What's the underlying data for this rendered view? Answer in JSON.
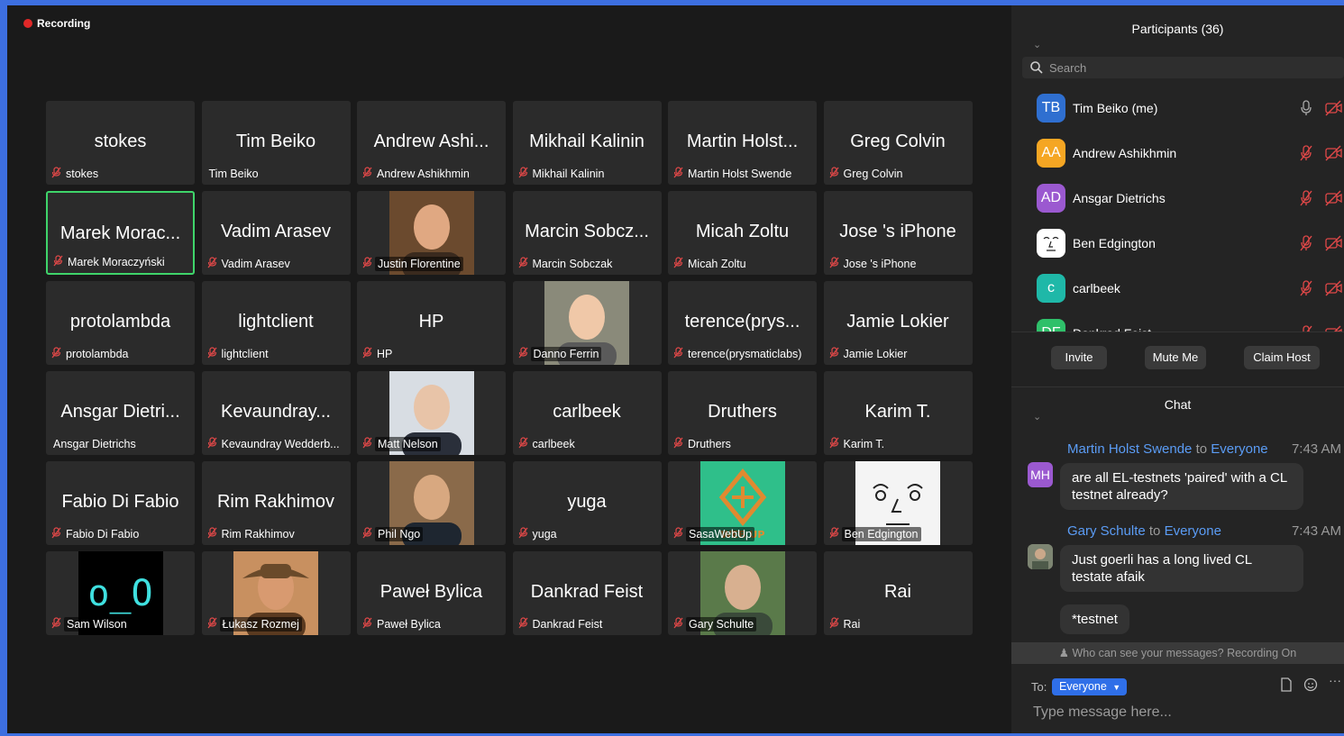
{
  "recording_label": "Recording",
  "tiles": [
    {
      "title": "stokes",
      "foot": "stokes",
      "muted": true,
      "photo": ""
    },
    {
      "title": "Tim Beiko",
      "foot": "Tim Beiko",
      "muted": false,
      "photo": ""
    },
    {
      "title": "Andrew Ashi...",
      "foot": "Andrew Ashikhmin",
      "muted": true,
      "photo": ""
    },
    {
      "title": "Mikhail Kalinin",
      "foot": "Mikhail Kalinin",
      "muted": true,
      "photo": ""
    },
    {
      "title": "Martin Holst...",
      "foot": "Martin Holst Swende",
      "muted": true,
      "photo": ""
    },
    {
      "title": "Greg Colvin",
      "foot": "Greg Colvin",
      "muted": true,
      "photo": ""
    },
    {
      "title": "Marek Morac...",
      "foot": "Marek Moraczyński",
      "muted": true,
      "photo": "",
      "active": true
    },
    {
      "title": "Vadim Arasev",
      "foot": "Vadim Arasev",
      "muted": true,
      "photo": ""
    },
    {
      "title": "",
      "foot": "Justin Florentine",
      "muted": true,
      "photo": "face-warm"
    },
    {
      "title": "Marcin Sobcz...",
      "foot": "Marcin Sobczak",
      "muted": true,
      "photo": ""
    },
    {
      "title": "Micah Zoltu",
      "foot": "Micah Zoltu",
      "muted": true,
      "photo": ""
    },
    {
      "title": "Jose 's iPhone",
      "foot": "Jose 's iPhone",
      "muted": true,
      "photo": ""
    },
    {
      "title": "protolambda",
      "foot": "protolambda",
      "muted": true,
      "photo": ""
    },
    {
      "title": "lightclient",
      "foot": "lightclient",
      "muted": true,
      "photo": ""
    },
    {
      "title": "HP",
      "foot": "HP",
      "muted": true,
      "photo": ""
    },
    {
      "title": "",
      "foot": "Danno Ferrin",
      "muted": true,
      "photo": "face-light"
    },
    {
      "title": "terence(prys...",
      "foot": "terence(prysmaticlabs)",
      "muted": true,
      "photo": ""
    },
    {
      "title": "Jamie Lokier",
      "foot": "Jamie Lokier",
      "muted": true,
      "photo": ""
    },
    {
      "title": "Ansgar Dietri...",
      "foot": "Ansgar Dietrichs",
      "muted": false,
      "photo": ""
    },
    {
      "title": "Kevaundray...",
      "foot": "Kevaundray Wedderb...",
      "muted": true,
      "photo": ""
    },
    {
      "title": "",
      "foot": "Matt Nelson",
      "muted": true,
      "photo": "face-office"
    },
    {
      "title": "carlbeek",
      "foot": "carlbeek",
      "muted": true,
      "photo": ""
    },
    {
      "title": "Druthers",
      "foot": "Druthers",
      "muted": true,
      "photo": ""
    },
    {
      "title": "Karim T.",
      "foot": "Karim T.",
      "muted": true,
      "photo": ""
    },
    {
      "title": "Fabio Di Fabio",
      "foot": "Fabio Di Fabio",
      "muted": true,
      "photo": ""
    },
    {
      "title": "Rim Rakhimov",
      "foot": "Rim Rakhimov",
      "muted": true,
      "photo": ""
    },
    {
      "title": "",
      "foot": "Phil Ngo",
      "muted": true,
      "photo": "face-suit"
    },
    {
      "title": "yuga",
      "foot": "yuga",
      "muted": true,
      "photo": ""
    },
    {
      "title": "",
      "foot": "SasaWebUp",
      "muted": true,
      "photo": "logo-green"
    },
    {
      "title": "",
      "foot": "Ben Edgington",
      "muted": true,
      "photo": "sketch"
    },
    {
      "title": "",
      "foot": "Sam Wilson",
      "muted": true,
      "photo": "terminal",
      "photo_text": "o_O"
    },
    {
      "title": "",
      "foot": "Łukasz Rozmej",
      "muted": true,
      "photo": "cowboy"
    },
    {
      "title": "Paweł Bylica",
      "foot": "Paweł Bylica",
      "muted": true,
      "photo": ""
    },
    {
      "title": "Dankrad Feist",
      "foot": "Dankrad Feist",
      "muted": true,
      "photo": ""
    },
    {
      "title": "",
      "foot": "Gary Schulte",
      "muted": true,
      "photo": "face-outdoor"
    },
    {
      "title": "Rai",
      "foot": "Rai",
      "muted": true,
      "photo": ""
    }
  ],
  "panel": {
    "participants_title": "Participants (36)",
    "search_placeholder": "Search",
    "participants": [
      {
        "initials": "TB",
        "name": "Tim Beiko (me)",
        "color": "#2f6fd0",
        "mic_muted": false
      },
      {
        "initials": "AA",
        "name": "Andrew Ashikhmin",
        "color": "#f5a623",
        "mic_muted": true
      },
      {
        "initials": "AD",
        "name": "Ansgar Dietrichs",
        "color": "#9b59d0",
        "mic_muted": true
      },
      {
        "initials": "",
        "name": "Ben Edgington",
        "color": "#ffffff",
        "mic_muted": true,
        "sketch": true
      },
      {
        "initials": "c",
        "name": "carlbeek",
        "color": "#1fb8a8",
        "mic_muted": true
      },
      {
        "initials": "DF",
        "name": "Dankrad Feist",
        "color": "#2fc06a",
        "mic_muted": true
      }
    ],
    "buttons": {
      "invite": "Invite",
      "mute": "Mute Me",
      "claim": "Claim Host"
    },
    "chat_title": "Chat",
    "messages": [
      {
        "sender": "Martin Holst Swende",
        "to_word": "to",
        "to": "Everyone",
        "time": "7:43 AM",
        "initials": "MH",
        "text": "are all EL-testnets 'paired' with a CL testnet already?"
      },
      {
        "sender": "Gary Schulte",
        "to_word": "to",
        "to": "Everyone",
        "time": "7:43 AM",
        "initials": "",
        "text": "Just goerli has a long lived CL testate afaik"
      },
      {
        "text": "*testnet"
      }
    ],
    "notice": "Who can see your messages? Recording On",
    "to_label": "To:",
    "to_value": "Everyone",
    "compose_placeholder": "Type message here..."
  }
}
